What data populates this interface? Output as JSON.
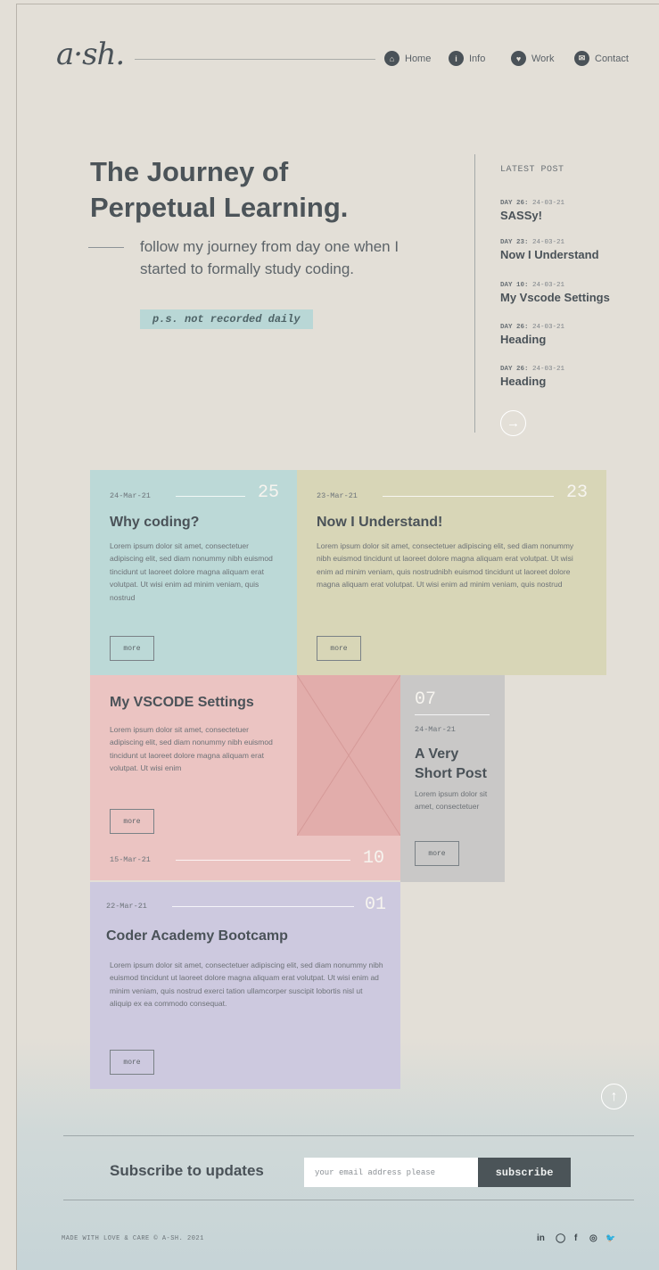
{
  "header": {
    "logo": "a·sh.",
    "nav": [
      {
        "label": "Home",
        "icon": "home-icon"
      },
      {
        "label": "Info",
        "icon": "info-icon"
      },
      {
        "label": "Work",
        "icon": "heart-icon"
      },
      {
        "label": "Contact",
        "icon": "mail-icon"
      }
    ]
  },
  "hero": {
    "title_line1": "The Journey of",
    "title_line2": "Perpetual Learning.",
    "subtitle": "follow my journey from day one when I started to formally study coding.",
    "ps": "p.s. not recorded daily"
  },
  "sidebar": {
    "heading": "LATEST POST",
    "posts": [
      {
        "day": "DAY 26:",
        "date": "24-03-21",
        "title": "SASSy!"
      },
      {
        "day": "DAY 23:",
        "date": "24-03-21",
        "title": "Now I Understand"
      },
      {
        "day": "DAY 10:",
        "date": "24-03-21",
        "title": "My Vscode Settings"
      },
      {
        "day": "DAY 26:",
        "date": "24-03-21",
        "title": "Heading"
      },
      {
        "day": "DAY 26:",
        "date": "24-03-21",
        "title": "Heading"
      }
    ]
  },
  "cards": {
    "why": {
      "date": "24-Mar-21",
      "num": "25",
      "title": "Why coding?",
      "body": "Lorem ipsum dolor sit amet, consectetuer adipiscing elit, sed diam nonummy nibh euismod tincidunt ut laoreet dolore magna aliquam erat volutpat. Ut wisi enim ad minim veniam, quis nostrud",
      "more": "more"
    },
    "understand": {
      "date": "23-Mar-21",
      "num": "23",
      "title": "Now I Understand!",
      "body": "Lorem ipsum dolor sit amet, consectetuer adipiscing elit, sed diam nonummy nibh euismod tincidunt ut laoreet dolore magna aliquam erat volutpat. Ut wisi enim ad minim veniam, quis nostrudnibh euismod tincidunt ut laoreet dolore magna aliquam erat volutpat. Ut wisi enim ad minim veniam, quis nostrud",
      "more": "more"
    },
    "vscode": {
      "date": "15-Mar-21",
      "num": "10",
      "title": "My VSCODE Settings",
      "body": "Lorem ipsum dolor sit amet, consectetuer adipiscing elit, sed diam nonummy nibh euismod tincidunt ut laoreet dolore magna aliquam erat volutpat. Ut wisi enim",
      "more": "more"
    },
    "short": {
      "date": "24-Mar-21",
      "num": "07",
      "title": "A Very Short Post",
      "body": "Lorem ipsum dolor sit amet, consectetuer",
      "more": "more"
    },
    "bootcamp": {
      "date": "22-Mar-21",
      "num": "01",
      "title": "Coder Academy Bootcamp",
      "body": "Lorem ipsum dolor sit amet, consectetuer adipiscing elit, sed diam nonummy nibh euismod tincidunt ut laoreet dolore magna aliquam erat volutpat. Ut wisi enim ad minim veniam, quis nostrud exerci tation ullamcorper suscipit lobortis nisl ut aliquip ex ea commodo consequat.",
      "more": "more"
    }
  },
  "subscribe": {
    "title": "Subscribe to updates",
    "placeholder": "your email address please",
    "button": "subscribe"
  },
  "footer": {
    "text": "MADE WITH LOVE & CARE © A-SH. 2021",
    "social": [
      "in",
      "◯",
      "f",
      "◎",
      "🐦"
    ]
  },
  "colors": {
    "background": "#e3dfd7",
    "teal": "#bcd9d7",
    "olive": "#d8d6b7",
    "pink": "#ebc4c2",
    "grey": "#c9c8c7",
    "lavender": "#cdc9df",
    "dark": "#4b5458"
  }
}
